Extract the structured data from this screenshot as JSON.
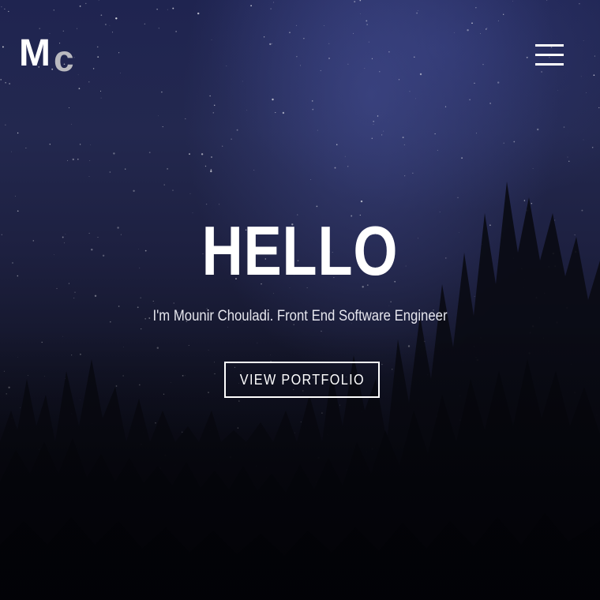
{
  "header": {
    "logo": {
      "primary": "M",
      "secondary": "c"
    },
    "menu_icon": "hamburger-menu-icon"
  },
  "hero": {
    "title": "HELLO",
    "subtitle": "I'm Mounir Chouladi. Front End Software Engineer",
    "cta_label": "VIEW PORTFOLIO"
  },
  "colors": {
    "sky_top": "#1f2450",
    "sky_bottom": "#040409",
    "text": "#ffffff",
    "logo_secondary": "#b9b9bf"
  }
}
